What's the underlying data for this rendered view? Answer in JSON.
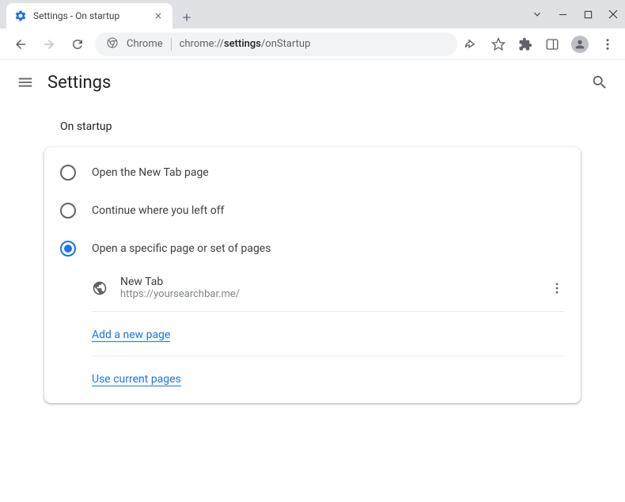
{
  "tab": {
    "title": "Settings - On startup"
  },
  "omnibox": {
    "chrome_label": "Chrome",
    "url_prefix": "chrome://",
    "url_path": "settings",
    "url_suffix": "/onStartup"
  },
  "header": {
    "title": "Settings"
  },
  "section": {
    "title": "On startup",
    "options": [
      {
        "label": "Open the New Tab page",
        "selected": false
      },
      {
        "label": "Continue where you left off",
        "selected": false
      },
      {
        "label": "Open a specific page or set of pages",
        "selected": true
      }
    ],
    "pages": [
      {
        "name": "New Tab",
        "url": "https://yoursearchbar.me/"
      }
    ],
    "add_page_label": "Add a new page",
    "use_current_label": "Use current pages"
  }
}
